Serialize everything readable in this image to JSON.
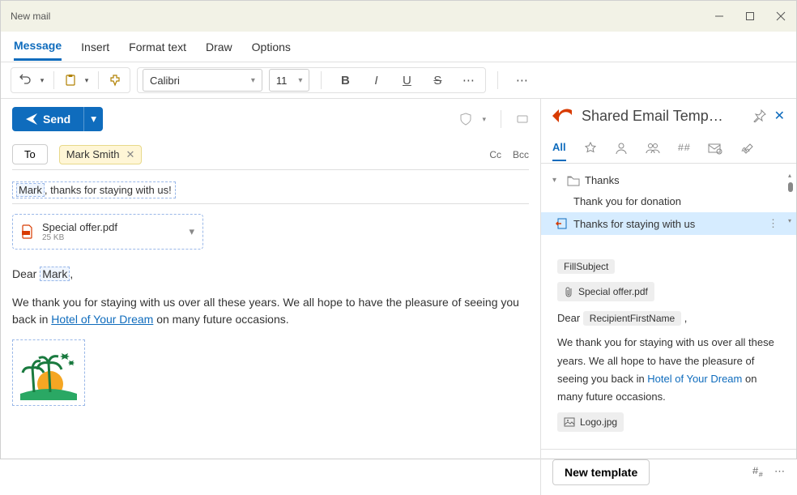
{
  "window": {
    "title": "New mail"
  },
  "tabs": [
    "Message",
    "Insert",
    "Format text",
    "Draw",
    "Options"
  ],
  "toolbar": {
    "font_name": "Calibri",
    "font_size": "11"
  },
  "compose": {
    "send_label": "Send",
    "to_label": "To",
    "recipient": "Mark Smith",
    "cc_label": "Cc",
    "bcc_label": "Bcc",
    "subject_macro": "Mark",
    "subject_rest": ", thanks for staying with us!",
    "attachment": {
      "name": "Special offer.pdf",
      "size": "25 KB"
    },
    "body": {
      "greeting_prefix": "Dear ",
      "greeting_macro": "Mark",
      "greeting_suffix": ",",
      "para_before_link": "We thank you for staying with us over all these years. We all hope to have the pleasure of seeing you back in ",
      "link_text": "Hotel of Your Dream",
      "para_after_link": " on many future occasions."
    }
  },
  "panel": {
    "title": "Shared Email Temp…",
    "tab_all": "All",
    "folder": "Thanks",
    "items": [
      "Thank you for donation",
      "Thanks for staying with us"
    ],
    "preview": {
      "fillsubject": "FillSubject",
      "attachment": "Special offer.pdf",
      "greeting_prefix": "Dear ",
      "recipient_macro": "RecipientFirstName",
      "greeting_suffix": " ,",
      "para_before_link": "We thank you for staying with us over all these years. We all hope to have the pleasure of seeing you back in ",
      "link_text": "Hotel of Your Dream",
      "para_after_link": " on many future occasions.",
      "logo": "Logo.jpg"
    },
    "footer": {
      "new_template": "New template"
    }
  }
}
